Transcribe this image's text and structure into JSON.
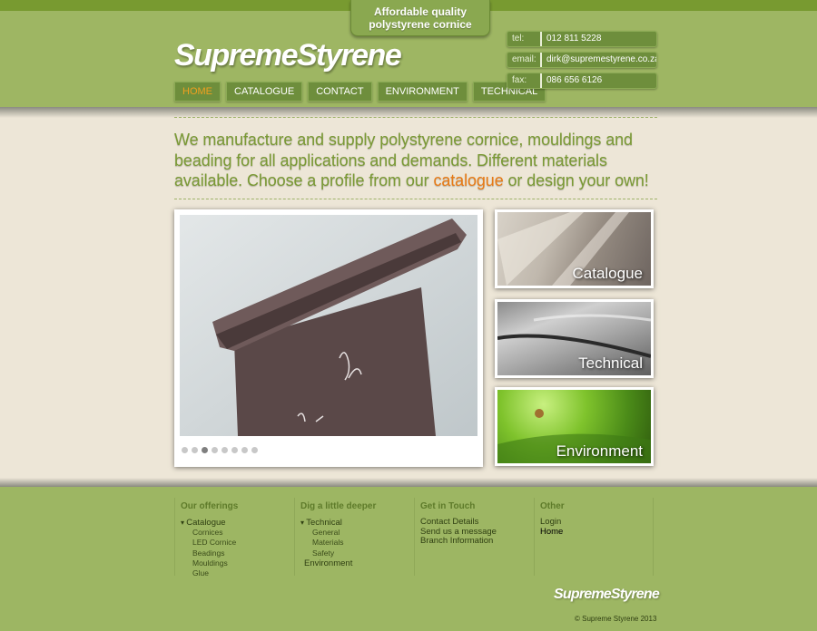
{
  "header": {
    "tagline_line1": "Affordable quality",
    "tagline_line2": "polystyrene cornice",
    "logo_text": "SupremeStyrene",
    "nav": [
      {
        "label": "HOME"
      },
      {
        "label": "CATALOGUE"
      },
      {
        "label": "CONTACT"
      },
      {
        "label": "ENVIRONMENT"
      },
      {
        "label": "TECHNICAL"
      }
    ],
    "contact": {
      "tel_label": "tel:",
      "tel_value": "012 811 5228",
      "email_label": "email:",
      "email_value": "dirk@supremestyrene.co.za",
      "fax_label": "fax:",
      "fax_value": "086 656 6126"
    }
  },
  "intro": {
    "text_before": "We manufacture and supply polystyrene cornice, mouldings and beading for all applications and demands. Different materials available. Choose a profile from our ",
    "highlight": "catalogue",
    "text_after": " or design your own!"
  },
  "slider": {
    "slide_count": 8,
    "active_index": 2
  },
  "tiles": [
    {
      "label": "Catalogue"
    },
    {
      "label": "Technical"
    },
    {
      "label": "Environment"
    }
  ],
  "footer": {
    "offerings": {
      "heading": "Our offerings",
      "parent": "Catalogue",
      "items": [
        "Cornices",
        "LED Cornice",
        "Beadings",
        "Mouldings",
        "Glue"
      ]
    },
    "deeper": {
      "heading": "Dig a little deeper",
      "parent": "Technical",
      "items": [
        "General",
        "Materials",
        "Safety"
      ],
      "extra": "Environment"
    },
    "touch": {
      "heading": "Get in Touch",
      "items": [
        "Contact Details",
        "Send us a message",
        "Branch Information"
      ]
    },
    "other": {
      "heading": "Other",
      "items": [
        "Login",
        "Home"
      ]
    },
    "logo_text": "SupremeStyrene",
    "copyright": "© Supreme Styrene 2013"
  }
}
